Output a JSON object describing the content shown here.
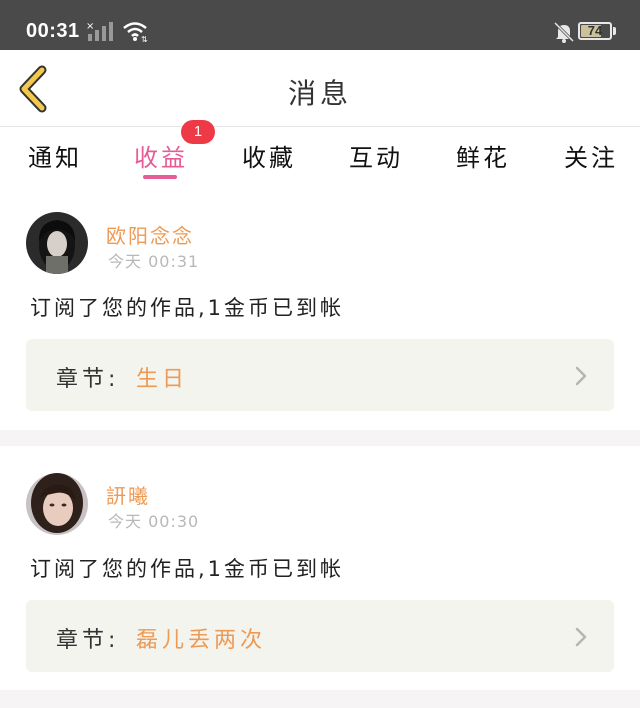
{
  "status_bar": {
    "time": "00:31",
    "battery": "74",
    "battery_level": 0.74
  },
  "header": {
    "title": "消息",
    "back_icon": "chevron-left-icon"
  },
  "tabs": [
    {
      "label": "通知"
    },
    {
      "label": "收益",
      "badge": "1",
      "active": true
    },
    {
      "label": "收藏"
    },
    {
      "label": "互动"
    },
    {
      "label": "鲜花"
    },
    {
      "label": "关注"
    }
  ],
  "messages": [
    {
      "name": "欧阳念念",
      "time": "今天 00:31",
      "text": "订阅了您的作品,1金币已到帐",
      "chapter_label": "章节:",
      "chapter_value": "生日"
    },
    {
      "name": "訮曦",
      "time": "今天 00:30",
      "text": "订阅了您的作品,1金币已到帐",
      "chapter_label": "章节:",
      "chapter_value": "磊儿丢两次"
    }
  ],
  "colors": {
    "accent": "#e65c96",
    "name": "#ed9a55",
    "badge": "#ee3a47",
    "back_arrow": "#f2c94c"
  }
}
